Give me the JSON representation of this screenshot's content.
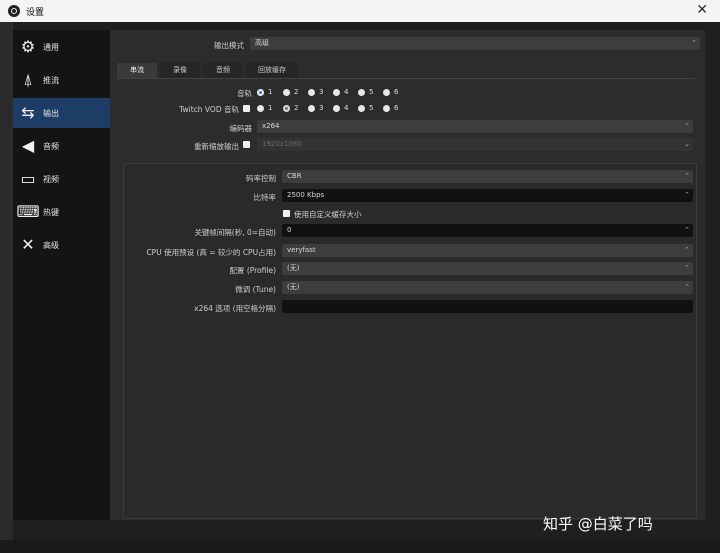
{
  "window": {
    "title": "设置",
    "close_glyph": "✕"
  },
  "sidebar": {
    "items": [
      {
        "label": "通用",
        "icon": "gear-icon",
        "glyph": "⚙",
        "active": false
      },
      {
        "label": "推流",
        "icon": "broadcast-icon",
        "glyph": "⍋",
        "active": false
      },
      {
        "label": "输出",
        "icon": "monitor-output-icon",
        "glyph": "⇆",
        "active": true
      },
      {
        "label": "音频",
        "icon": "speaker-icon",
        "glyph": "◀",
        "active": false
      },
      {
        "label": "视频",
        "icon": "monitor-icon",
        "glyph": "▭",
        "active": false
      },
      {
        "label": "热键",
        "icon": "keyboard-icon",
        "glyph": "⌨",
        "active": false
      },
      {
        "label": "高级",
        "icon": "tools-icon",
        "glyph": "✕",
        "active": false
      }
    ]
  },
  "output_mode": {
    "label": "输出模式",
    "value": "高级"
  },
  "tabs": [
    {
      "label": "串流",
      "active": true
    },
    {
      "label": "录像",
      "active": false
    },
    {
      "label": "音频",
      "active": false
    },
    {
      "label": "回放缓存",
      "active": false
    }
  ],
  "audio_track": {
    "label": "音轨",
    "options": [
      "1",
      "2",
      "3",
      "4",
      "5",
      "6"
    ],
    "selected": "1"
  },
  "twitch_vod": {
    "label": "Twitch VOD 音轨",
    "options": [
      "1",
      "2",
      "3",
      "4",
      "5",
      "6"
    ],
    "selected": "2"
  },
  "encoder": {
    "label": "编码器",
    "value": "x264"
  },
  "rescale": {
    "label": "重新缩放输出",
    "value": "1920x1080"
  },
  "rate_control": {
    "label": "码率控制",
    "value": "CBR"
  },
  "bitrate": {
    "label": "比特率",
    "value": "2500 Kbps"
  },
  "custom_buffer": {
    "label": "使用自定义缓存大小"
  },
  "keyframe": {
    "label": "关键帧间隔(秒, 0=自动)",
    "value": "0"
  },
  "cpu_preset": {
    "label": "CPU 使用预设 (高 = 较少的 CPU占用)",
    "value": "veryfast"
  },
  "profile": {
    "label": "配置 (Profile)",
    "value": "(无)"
  },
  "tune": {
    "label": "微调 (Tune)",
    "value": "(无)"
  },
  "x264_opts": {
    "label": "x264 选项 (用空格分隔)",
    "value": ""
  },
  "watermark": "知乎 @白菜了吗",
  "colors": {
    "accent": "#1d3d66",
    "radio_accent": "#3b7ed8",
    "background": "#2c2c2c"
  }
}
